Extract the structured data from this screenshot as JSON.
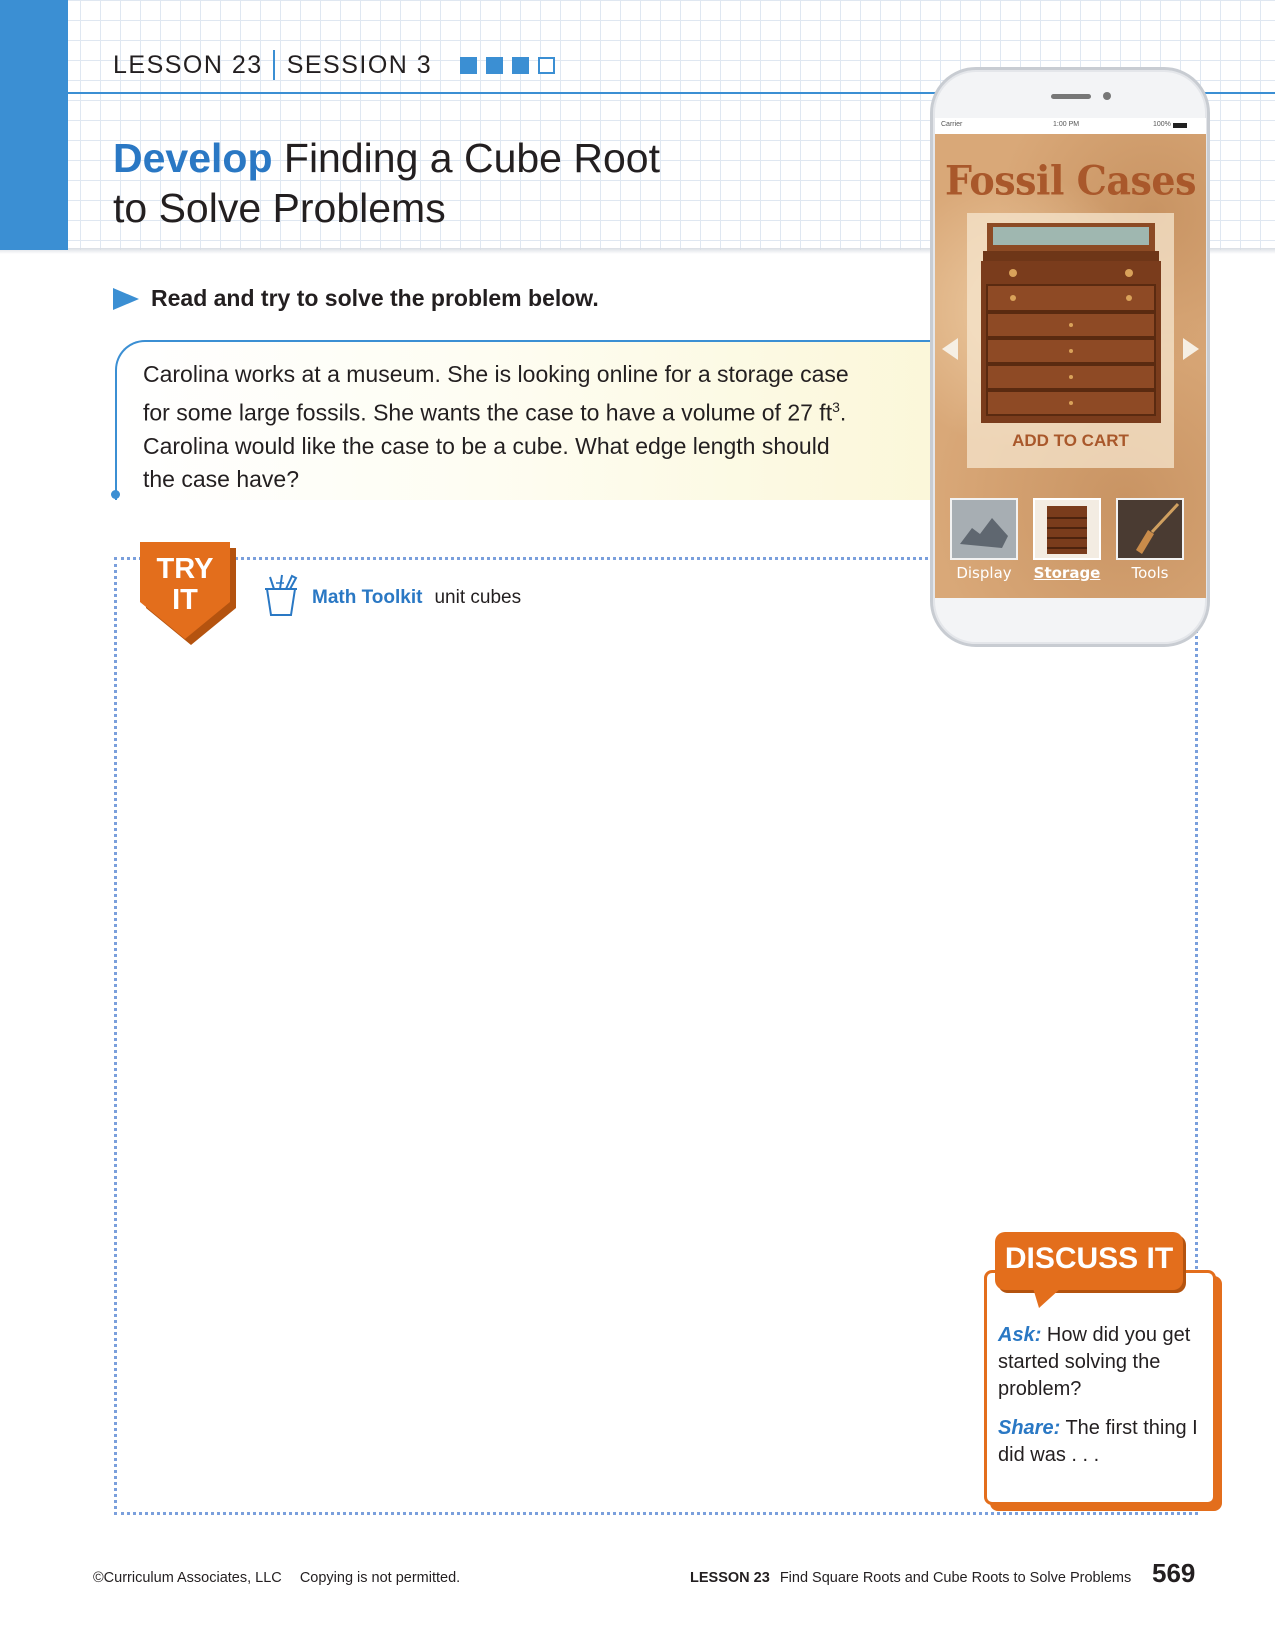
{
  "header": {
    "lesson": "LESSON 23",
    "session": "SESSION 3",
    "progress": {
      "completed": 3,
      "total": 4
    },
    "title_keyword": "Develop",
    "title_rest_line1": "Finding a Cube Root",
    "title_line2": "to Solve Problems"
  },
  "prompt": {
    "instruction": "Read and try to solve the problem below."
  },
  "problem": {
    "text_part1": "Carolina works at a museum. She is looking online for a storage case for some large fossils. She wants the case to have a volume of 27 ft",
    "superscript": "3",
    "text_part2": ". Carolina would like the case to be a cube. What edge length should the case have?"
  },
  "try_it": {
    "badge_line1": "TRY",
    "badge_line2": "IT",
    "toolkit_label": "Math Toolkit",
    "toolkit_item": "unit cubes"
  },
  "phone": {
    "status_carrier": "Carrier",
    "status_time": "1:00 PM",
    "status_battery": "100%",
    "app_title": "Fossil Cases",
    "add_to_cart": "ADD TO CART",
    "thumbnails": [
      {
        "label": "Display",
        "selected": false
      },
      {
        "label": "Storage",
        "selected": true
      },
      {
        "label": "Tools",
        "selected": false
      }
    ]
  },
  "discuss": {
    "title": "DISCUSS IT",
    "ask_label": "Ask:",
    "ask_text": "How did you get started solving the problem?",
    "share_label": "Share:",
    "share_text": "The first thing I did was . . ."
  },
  "footer": {
    "copyright": "©Curriculum Associates, LLC",
    "copy_notice": "Copying is not permitted.",
    "lesson_label": "LESSON 23",
    "lesson_title": "Find Square Roots and Cube Roots to Solve Problems",
    "page_number": "569"
  },
  "colors": {
    "brand_blue": "#3b8fd3",
    "title_blue": "#2a78c4",
    "accent_orange": "#e36e1c",
    "fossil_brown": "#a9582b"
  }
}
